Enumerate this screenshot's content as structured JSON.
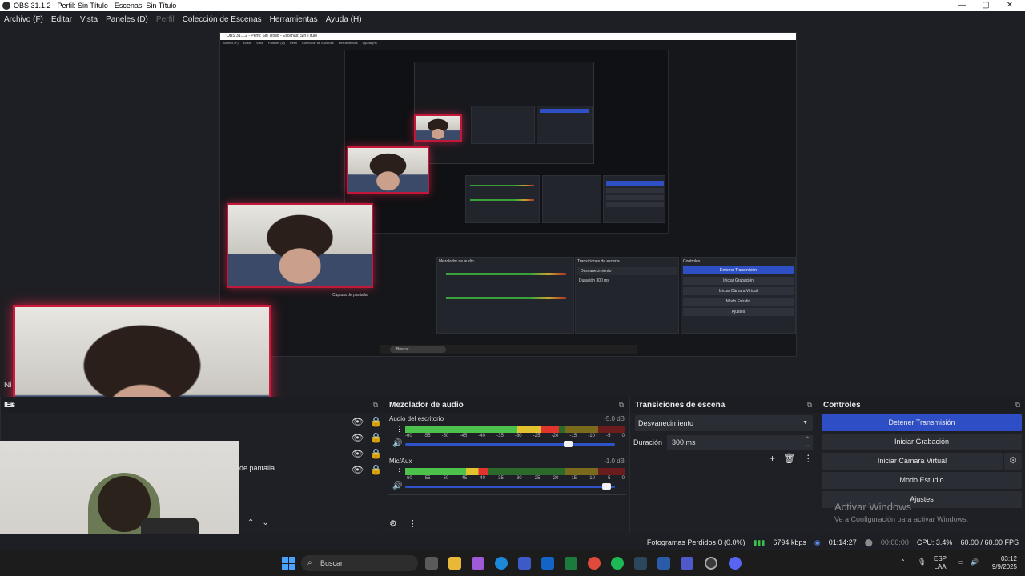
{
  "window": {
    "title": "OBS 31.1.2 - Perfil: Sin Título - Escenas: Sin Título",
    "minimize": "—",
    "maximize": "▢",
    "close": "✕"
  },
  "menu": {
    "archivo": "Archivo (F)",
    "editar": "Editar",
    "vista": "Vista",
    "paneles": "Paneles (D)",
    "perfil": "Perfil",
    "coleccion": "Colección de Escenas",
    "herramientas": "Herramientas",
    "ayuda": "Ayuda (H)"
  },
  "sources": {
    "partial_label_1": "Es",
    "partial_label_2": "Es",
    "partial_label_3": "Ni",
    "source_name_partial": "de pantalla",
    "eye_icon": "eye-icon",
    "lock_icon": "lock-icon"
  },
  "mixer": {
    "title": "Mezclador de audio",
    "channels": [
      {
        "name": "Audio del escritorio",
        "db": "-5.0 dB",
        "level": 0.7,
        "volume": 0.78
      },
      {
        "name": "Mic/Aux",
        "db": "-1.0 dB",
        "level": 0.38,
        "volume": 0.96
      }
    ],
    "ticks": [
      "-60",
      "-55",
      "-50",
      "-45",
      "-40",
      "-35",
      "-30",
      "-25",
      "-20",
      "-15",
      "-10",
      "-5",
      "0"
    ]
  },
  "transitions": {
    "title": "Transiciones de escena",
    "selected": "Desvanecimiento",
    "duration_label": "Duración",
    "duration_value": "300 ms"
  },
  "controls": {
    "title": "Controles",
    "stop_stream": "Detener Transmisión",
    "start_recording": "Iniciar Grabación",
    "start_virtual_cam": "Iniciar Cámara Virtual",
    "studio_mode": "Modo Estudio",
    "settings": "Ajustes"
  },
  "watermark": {
    "line1": "Activar Windows",
    "line2": "Ve a Configuración para activar Windows."
  },
  "status": {
    "dropped_frames": "Fotogramas Perdidos 0 (0.0%)",
    "bitrate": "6794 kbps",
    "stream_time": "01:14:27",
    "rec_time": "00:00:00",
    "cpu": "CPU: 3.4%",
    "fps": "60.00 / 60.00 FPS"
  },
  "taskbar": {
    "search": "Buscar",
    "lang_top": "ESP",
    "lang_bottom": "LAA",
    "time": "03:12",
    "date": "9/9/2025"
  },
  "nested_preview": {
    "inner_title": "OBS 31.1.2 - Perfil: Sin Título - Escenas: Sin Título",
    "inner_menu": [
      "Archivo (F)",
      "Editar",
      "Vista",
      "Paneles (D)",
      "Perfil",
      "Colección de Escenas",
      "Herramientas",
      "Ayuda (H)"
    ],
    "inner_mixer": "Mezclador de audio",
    "inner_transitions": "Transiciones de escena",
    "inner_controls": "Controles",
    "inner_stop": "Detener Transmisión",
    "inner_rec": "Iniciar Grabación",
    "inner_vcam": "Iniciar Cámara Virtual",
    "inner_studio": "Modo Estudio",
    "inner_settings": "Ajustes",
    "inner_capture": "Captura de pantalla",
    "inner_fade": "Desvanecimiento",
    "inner_duration": "Duración",
    "inner_ms": "300 ms",
    "inner_search": "Buscar"
  }
}
